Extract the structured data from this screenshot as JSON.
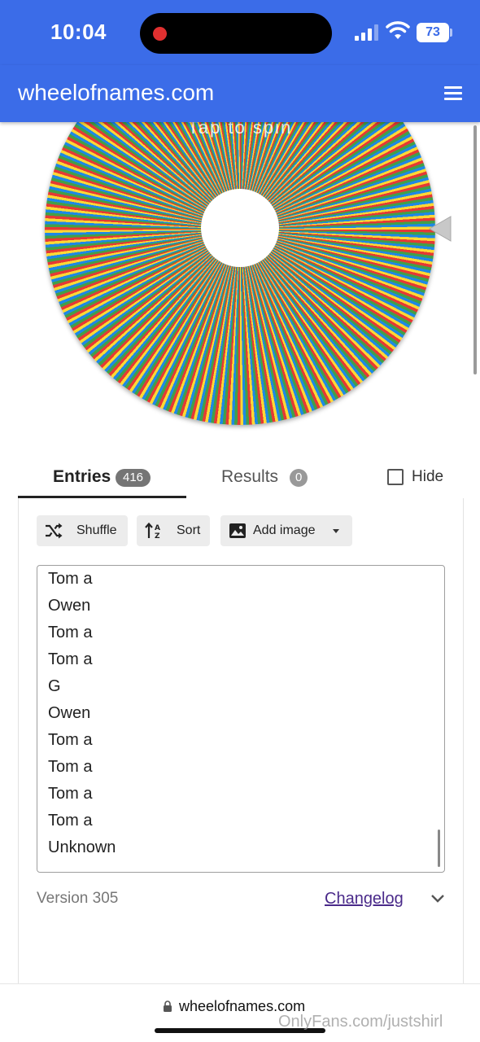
{
  "status_bar": {
    "time": "10:04",
    "battery": "73"
  },
  "app_bar": {
    "title": "wheelofnames.com",
    "menu_icon": "hamburger-menu-icon"
  },
  "wheel": {
    "overlay_text": "Tap to spin",
    "colors": [
      "#e53935",
      "#43a047",
      "#1e88e5",
      "#fdd835"
    ]
  },
  "tabs": {
    "entries": {
      "label": "Entries",
      "count": "416"
    },
    "results": {
      "label": "Results",
      "count": "0"
    },
    "hide": {
      "label": "Hide",
      "checked": false
    }
  },
  "toolbar": {
    "shuffle": {
      "label": "Shuffle",
      "icon": "shuffle-icon"
    },
    "sort": {
      "label": "Sort",
      "icon": "sort-icon"
    },
    "add_image": {
      "label": "Add image",
      "icon": "image-icon"
    }
  },
  "entries": [
    "Tom a",
    "Owen",
    "Tom a",
    "Tom a",
    "G",
    "Owen",
    "Tom a",
    "Tom a",
    "Tom a",
    "Tom a",
    "Unknown"
  ],
  "footer": {
    "version": "Version 305",
    "changelog": "Changelog"
  },
  "browser": {
    "url": "wheelofnames.com"
  },
  "watermark": "OnlyFans.com/justshirl",
  "accent_color": "#3b6ce8"
}
